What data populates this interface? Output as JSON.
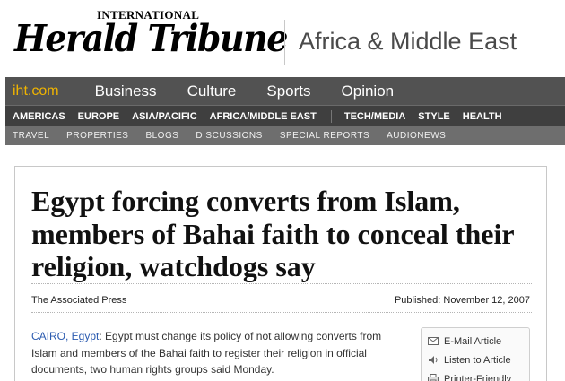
{
  "masthead": {
    "kicker": "INTERNATIONAL",
    "brand": "Herald Tribune",
    "section": "Africa & Middle East"
  },
  "nav": {
    "primary": [
      "iht.com",
      "Business",
      "Culture",
      "Sports",
      "Opinion"
    ],
    "secondary": [
      "AMERICAS",
      "EUROPE",
      "ASIA/PACIFIC",
      "AFRICA/MIDDLE EAST",
      "TECH/MEDIA",
      "STYLE",
      "HEALTH"
    ],
    "tertiary": [
      "TRAVEL",
      "PROPERTIES",
      "BLOGS",
      "DISCUSSIONS",
      "SPECIAL REPORTS",
      "AUDIONEWS"
    ]
  },
  "article": {
    "headline": "Egypt forcing converts from Islam, members of Bahai faith to conceal their religion, watchdogs say",
    "byline": "The Associated Press",
    "published": "Published: November 12, 2007",
    "dateline": "CAIRO, Egypt",
    "body": ": Egypt must change its policy of not allowing converts from Islam and members of the Bahai faith to register their religion in official documents, two human rights groups said Monday."
  },
  "tools": [
    {
      "label": "E-Mail Article",
      "icon": "email-icon"
    },
    {
      "label": "Listen to Article",
      "icon": "speaker-icon"
    },
    {
      "label": "Printer-Friendly",
      "icon": "printer-icon"
    }
  ],
  "colors": {
    "brand_accent": "#f0b400",
    "nav_primary_bg": "#525252",
    "nav_secondary_bg": "#3f3f3f",
    "nav_tertiary_bg": "#6e6e6e",
    "dateline": "#2b5bb0"
  }
}
